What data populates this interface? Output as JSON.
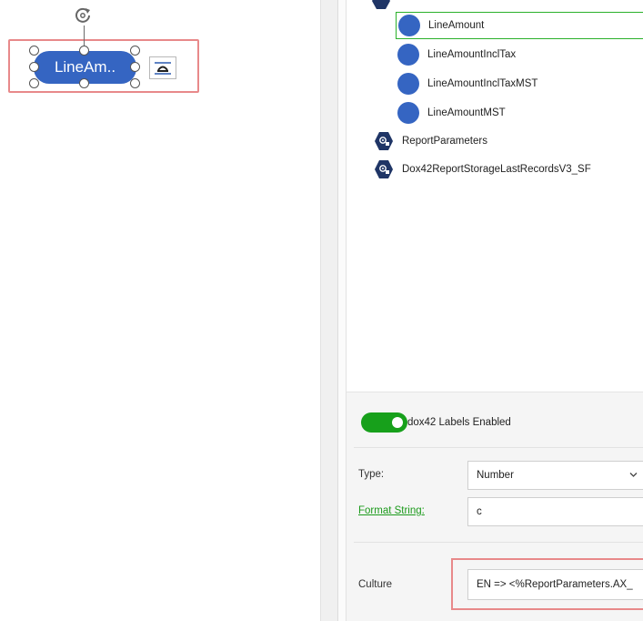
{
  "canvas": {
    "selected_label": "LineAm.."
  },
  "tree": {
    "items": [
      {
        "label": "LineAmount",
        "icon": "circle",
        "selected": true
      },
      {
        "label": "LineAmountInclTax",
        "icon": "circle",
        "selected": false
      },
      {
        "label": "LineAmountInclTaxMST",
        "icon": "circle",
        "selected": false
      },
      {
        "label": "LineAmountMST",
        "icon": "circle",
        "selected": false
      },
      {
        "label": "ReportParameters",
        "icon": "hexagon",
        "selected": false
      },
      {
        "label": "Dox42ReportStorageLastRecordsV3_SF",
        "icon": "hexagon",
        "selected": false
      }
    ]
  },
  "properties": {
    "labels_toggle": {
      "label": "dox42 Labels Enabled",
      "on": true
    },
    "type": {
      "label": "Type:",
      "value": "Number"
    },
    "format_string": {
      "label": "Format String:",
      "value": "c"
    },
    "culture": {
      "label": "Culture",
      "value": "EN => <%ReportParameters.AX_"
    }
  },
  "colors": {
    "accent_blue": "#3565c2",
    "toggle_green": "#17a01b",
    "selection_green": "#2bb12b",
    "highlight_red": "#e8898a",
    "hex_navy": "#1f3566"
  }
}
